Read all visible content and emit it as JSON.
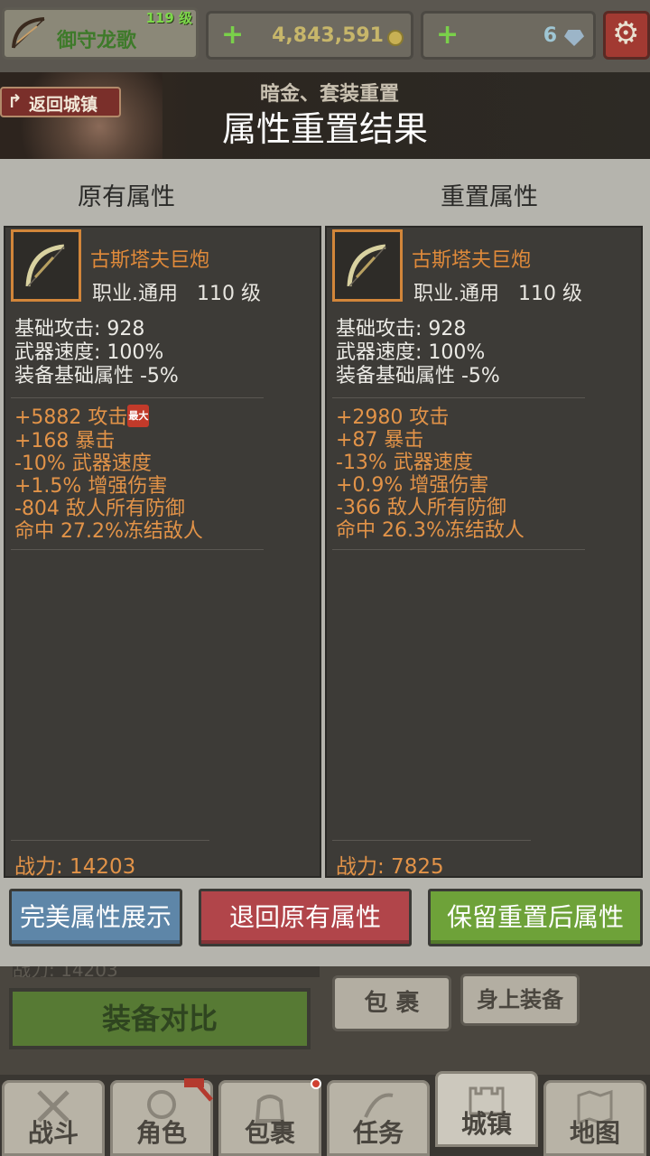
{
  "top": {
    "player_name": "御守龙歌",
    "level": "119 级",
    "gold": "4,843,591",
    "gems": "6",
    "plus": "+"
  },
  "banner": {
    "back_label": "返回城镇",
    "subtitle": "暗金、套装重置",
    "title": "属性重置结果"
  },
  "columns": {
    "original_header": "原有属性",
    "reset_header": "重置属性"
  },
  "original": {
    "item_name": "古斯塔夫巨炮",
    "item_class": "职业.通用   110 级",
    "base": [
      "基础攻击:  928",
      "武器速度:  100%",
      "装备基础属性 -5%"
    ],
    "stats": [
      "+5882 攻击",
      "+168 暴击",
      "-10% 武器速度",
      "+1.5% 增强伤害",
      "-804 敌人所有防御",
      "命中 27.2%冻结敌人"
    ],
    "max_tag": "最大",
    "power": "战力:  14203"
  },
  "reset": {
    "item_name": "古斯塔夫巨炮",
    "item_class": "职业.通用   110 级",
    "base": [
      "基础攻击:  928",
      "武器速度:  100%",
      "装备基础属性 -5%"
    ],
    "stats": [
      "+2980 攻击",
      "+87 暴击",
      "-13% 武器速度",
      "+0.9% 增强伤害",
      "-366 敌人所有防御",
      "命中 26.3%冻结敌人"
    ],
    "power": "战力:  7825"
  },
  "actions": {
    "perfect": "完美属性展示",
    "revert": "退回原有属性",
    "keep": "保留重置后属性"
  },
  "lower": {
    "compare": "装备对比",
    "pack": "包 裹",
    "equipped": "身上装备",
    "partial_text": "战力:  14203"
  },
  "nav": [
    "战斗",
    "角色",
    "包裹",
    "任务",
    "城镇",
    "地图"
  ],
  "colors": {
    "orange": "#e29348",
    "green_button": "#6ea239",
    "red_button": "#b1454a",
    "blue_button": "#5e86a8"
  }
}
